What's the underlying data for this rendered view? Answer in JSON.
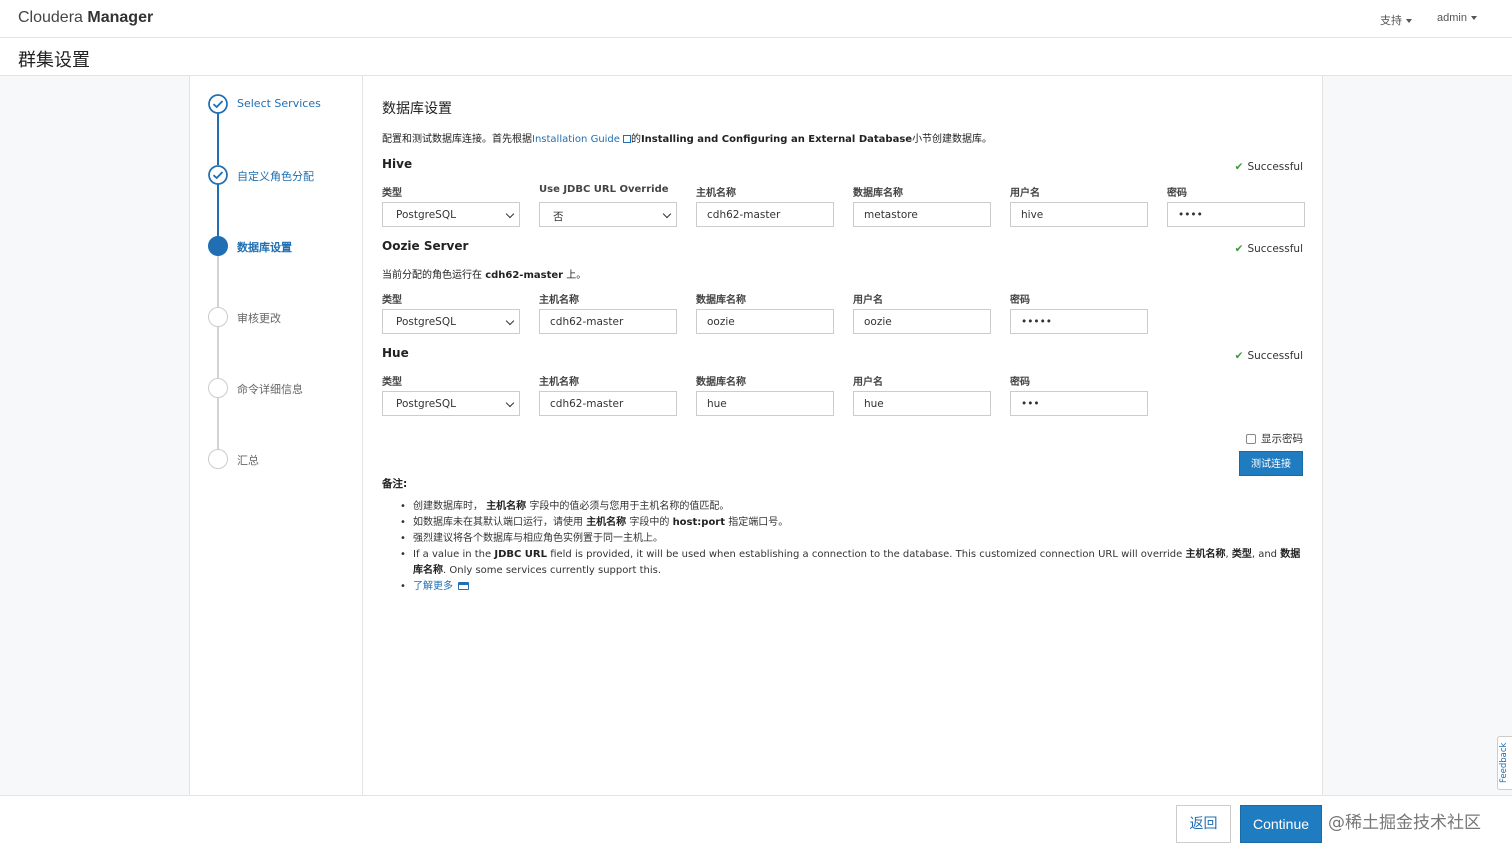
{
  "header": {
    "brand_light": "Cloudera",
    "brand_bold": "Manager",
    "support_label": "支持",
    "user_label": "admin"
  },
  "page_title": "群集设置",
  "steps": [
    {
      "label": "Select Services",
      "state": "done"
    },
    {
      "label": "自定义角色分配",
      "state": "done"
    },
    {
      "label": "数据库设置",
      "state": "current"
    },
    {
      "label": "审核更改",
      "state": "todo"
    },
    {
      "label": "命令详细信息",
      "state": "todo"
    },
    {
      "label": "汇总",
      "state": "todo"
    }
  ],
  "main": {
    "heading": "数据库设置",
    "intro_prefix": "配置和测试数据库连接。首先根据",
    "intro_link": "Installation Guide",
    "intro_mid": "的",
    "intro_bold": "Installing and Configuring an External Database",
    "intro_suffix": "小节创建数据库。",
    "hive": {
      "title": "Hive",
      "status": "Successful",
      "labels": {
        "type": "类型",
        "jdbc": "Use JDBC URL Override",
        "host": "主机名称",
        "db": "数据库名称",
        "user": "用户名",
        "pw": "密码"
      },
      "type": "PostgreSQL",
      "jdbc": "否",
      "host": "cdh62-master",
      "db": "metastore",
      "user": "hive",
      "pw": "••••"
    },
    "oozie": {
      "title": "Oozie Server",
      "status": "Successful",
      "note_prefix": "当前分配的角色运行在",
      "note_host": "cdh62-master",
      "note_suffix": "上。",
      "labels": {
        "type": "类型",
        "host": "主机名称",
        "db": "数据库名称",
        "user": "用户名",
        "pw": "密码"
      },
      "type": "PostgreSQL",
      "host": "cdh62-master",
      "db": "oozie",
      "user": "oozie",
      "pw": "•••••"
    },
    "hue": {
      "title": "Hue",
      "status": "Successful",
      "labels": {
        "type": "类型",
        "host": "主机名称",
        "db": "数据库名称",
        "user": "用户名",
        "pw": "密码"
      },
      "type": "PostgreSQL",
      "host": "cdh62-master",
      "db": "hue",
      "user": "hue",
      "pw": "•••"
    },
    "show_password_label": "显示密码",
    "test_button": "测试连接",
    "notes_title": "备注:",
    "notes": {
      "n1_a": "创建数据库时，",
      "n1_b": "主机名称",
      "n1_c": "字段中的值必须与您用于主机名称的值匹配。",
      "n2_a": "如数据库未在其默认端口运行，请使用",
      "n2_b": "主机名称",
      "n2_c": "字段中的",
      "n2_d": "host:port",
      "n2_e": "指定端口号。",
      "n3": "强烈建议将各个数据库与相应角色实例置于同一主机上。",
      "n4_a": "If a value in the",
      "n4_b": "JDBC URL",
      "n4_c": "field is provided, it will be used when establishing a connection to the database. This customized connection URL will override",
      "n4_d": "主机名称",
      "n4_e": "类型",
      "n4_f": "and",
      "n4_g": "数据库名称",
      "n4_h": ". Only some services currently support this.",
      "learn_more": "了解更多"
    }
  },
  "footer": {
    "back_label": "返回",
    "continue_label": "Continue",
    "watermark": "@稀土掘金技术社区",
    "feedback": "Feedback"
  },
  "colors": {
    "accent": "#1f7cc0",
    "success": "#3c9a3c",
    "link": "#1f6fb2"
  }
}
